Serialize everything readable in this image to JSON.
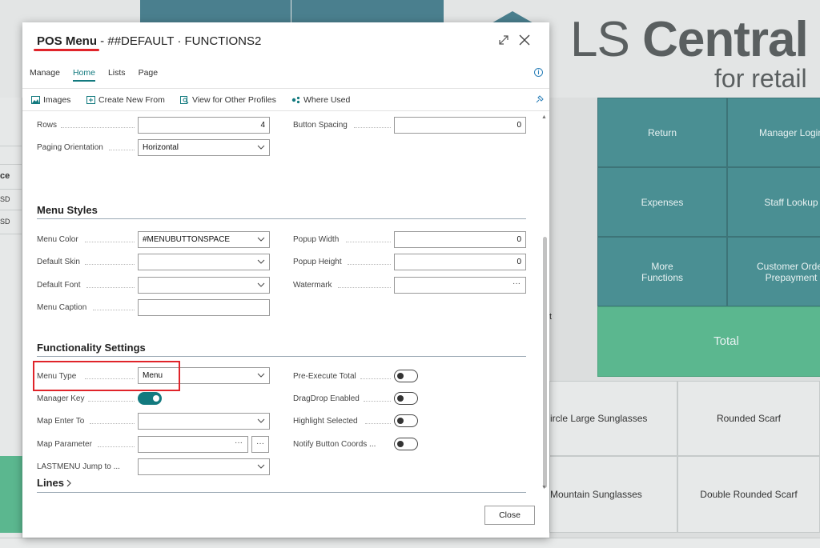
{
  "background": {
    "brand_regular": "LS ",
    "brand_bold": "Central",
    "brand_sub": "for retail",
    "tiles": [
      "Return",
      "Manager Login",
      "Expenses",
      "Staff Lookup",
      "More\nFunctions",
      "Customer Order\nPrepayment",
      "Total"
    ],
    "items": [
      "ircle Large Sunglasses",
      "Rounded Scarf",
      "Mountain Sunglasses",
      "Double Rounded Scarf"
    ],
    "left_labels": [
      "ce",
      "SD",
      "SD"
    ],
    "mid_label": "t"
  },
  "dialog": {
    "title_main": "POS Menu",
    "title_rest": " - ##DEFAULT · FUNCTIONS2",
    "tabs": [
      "Manage",
      "Home",
      "Lists",
      "Page"
    ],
    "active_tab": "Home",
    "actions": {
      "images": "Images",
      "create_new_from": "Create New From",
      "view_other_profiles": "View for Other Profiles",
      "where_used": "Where Used"
    },
    "fields": {
      "rows_label": "Rows",
      "rows_value": "4",
      "button_spacing_label": "Button Spacing",
      "button_spacing_value": "0",
      "paging_orientation_label": "Paging Orientation",
      "paging_orientation_value": "Horizontal"
    },
    "menu_styles": {
      "heading": "Menu Styles",
      "menu_color_label": "Menu Color",
      "menu_color_value": "#MENUBUTTONSPACE",
      "default_skin_label": "Default Skin",
      "default_skin_value": "",
      "default_font_label": "Default Font",
      "default_font_value": "",
      "menu_caption_label": "Menu Caption",
      "menu_caption_value": "",
      "popup_width_label": "Popup Width",
      "popup_width_value": "0",
      "popup_height_label": "Popup Height",
      "popup_height_value": "0",
      "watermark_label": "Watermark",
      "watermark_value": ""
    },
    "functionality": {
      "heading": "Functionality Settings",
      "menu_type_label": "Menu Type",
      "menu_type_value": "Menu",
      "manager_key_label": "Manager Key",
      "manager_key_on": true,
      "map_enter_to_label": "Map Enter To",
      "map_enter_to_value": "",
      "map_parameter_label": "Map Parameter",
      "map_parameter_value": "",
      "lastmenu_label": "LASTMENU Jump to ...",
      "lastmenu_value": "",
      "pre_execute_total_label": "Pre-Execute Total",
      "pre_execute_total_on": false,
      "dragdrop_label": "DragDrop Enabled",
      "dragdrop_on": false,
      "highlight_selected_label": "Highlight Selected",
      "highlight_selected_on": false,
      "notify_button_coords_label": "Notify Button Coords ...",
      "notify_button_coords_on": false
    },
    "lines_heading": "Lines",
    "close_label": "Close"
  },
  "colors": {
    "accent": "#137a7f",
    "highlight": "#e0242a",
    "tile": "#4a8f93",
    "total_tile": "#5bb78f"
  }
}
